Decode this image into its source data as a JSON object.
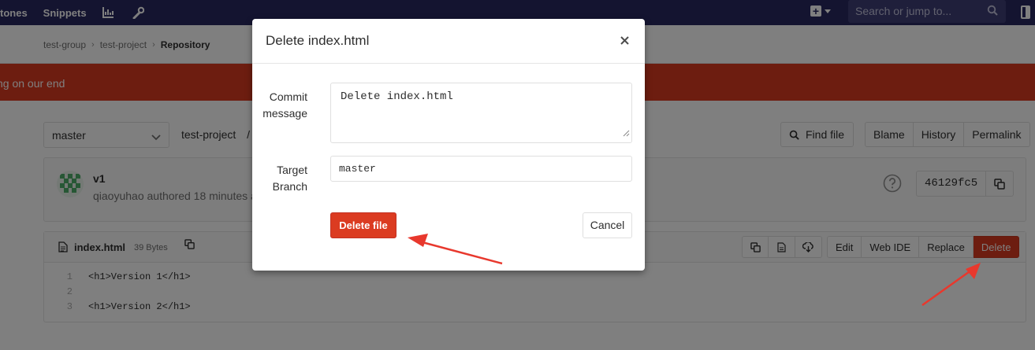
{
  "topnav": {
    "items": [
      "tones",
      "Snippets"
    ],
    "search_placeholder": "Search or jump to..."
  },
  "breadcrumb": {
    "items": [
      "test-group",
      "test-project"
    ],
    "current": "Repository"
  },
  "flash": {
    "message": "ng on our end"
  },
  "repo": {
    "branch": "master",
    "path": "test-project",
    "path_sep": "/",
    "find_file_label": "Find file",
    "view_buttons": [
      "Blame",
      "History",
      "Permalink"
    ]
  },
  "commit": {
    "title": "v1",
    "meta": "qiaoyuhao authored 18 minutes ago",
    "sha": "46129fc5"
  },
  "file": {
    "name": "index.html",
    "size": "39 Bytes",
    "actions": [
      "Edit",
      "Web IDE",
      "Replace"
    ],
    "delete_label": "Delete",
    "lines": [
      {
        "num": "1",
        "text": "<h1>Version 1</h1>"
      },
      {
        "num": "2",
        "text": ""
      },
      {
        "num": "3",
        "text": "<h1>Version 2</h1>"
      }
    ]
  },
  "modal": {
    "title": "Delete index.html",
    "close_glyph": "×",
    "commit_label": "Commit\nmessage",
    "commit_value": "Delete index.html",
    "branch_label": "Target\nBranch",
    "branch_value": "master",
    "delete_button": "Delete file",
    "cancel_button": "Cancel"
  },
  "colors": {
    "navbar": "#292961",
    "danger": "#db3b21",
    "annotation_arrow": "#e8382d"
  }
}
